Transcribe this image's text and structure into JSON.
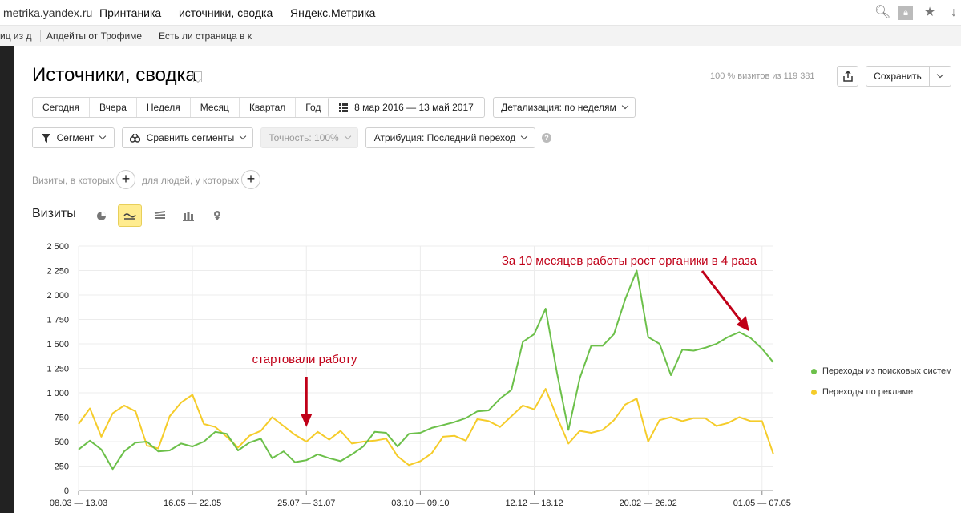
{
  "browser": {
    "url": "metrika.yandex.ru",
    "tab_title": "Принтаника — источники, сводка — Яндекс.Метрика",
    "bookmarks": [
      "иц из д",
      "Апдейты от Трофиме",
      "Есть ли страница в к"
    ],
    "icons": [
      "search-icon",
      "lock-icon",
      "star-icon",
      "download-icon"
    ]
  },
  "page": {
    "title": "Источники, сводка",
    "visits_info": "100 % визитов из 119 381",
    "save_label": "Сохранить"
  },
  "periods": [
    "Сегодня",
    "Вчера",
    "Неделя",
    "Месяц",
    "Квартал",
    "Год"
  ],
  "date_range": "8 мар 2016 — 13 май 2017",
  "detail_label": "Детализация: по неделям",
  "segment_label": "Сегмент",
  "compare_label": "Сравнить сегменты",
  "accuracy_label": "Точность: 100%",
  "attribution_label": "Атрибуция: Последний переход",
  "filters": {
    "visits_label": "Визиты, в которых",
    "people_label": "для людей, у которых"
  },
  "chart_section": {
    "title": "Визиты",
    "types": [
      "pie-chart-icon",
      "line-chart-icon",
      "area-chart-icon",
      "bar-chart-icon",
      "map-icon"
    ]
  },
  "colors": {
    "organic": "#6cc04a",
    "ads": "#f5cc2a",
    "annotation": "#c00018",
    "accent": "#ffec8f"
  },
  "chart_data": {
    "type": "line",
    "ylim": [
      0,
      2500
    ],
    "yticks": [
      0,
      250,
      500,
      750,
      1000,
      1250,
      1500,
      1750,
      2000,
      2250,
      2500
    ],
    "ytick_labels": [
      "0",
      "250",
      "500",
      "750",
      "1 000",
      "1 250",
      "1 500",
      "1 750",
      "2 000",
      "2 250",
      "2 500"
    ],
    "xtick_labels": [
      "08.03 — 13.03",
      "16.05 — 22.05",
      "25.07 — 31.07",
      "03.10 — 09.10",
      "12.12 — 18.12",
      "20.02 — 26.02",
      "01.05 — 07.05"
    ],
    "xtick_positions": [
      0,
      10,
      20,
      30,
      40,
      50,
      60
    ],
    "series": [
      {
        "name": "Переходы из поисковых систем",
        "values": [
          420,
          510,
          420,
          220,
          400,
          490,
          500,
          400,
          410,
          480,
          450,
          500,
          600,
          580,
          410,
          490,
          530,
          330,
          400,
          290,
          310,
          370,
          330,
          300,
          370,
          450,
          600,
          590,
          450,
          580,
          590,
          640,
          670,
          700,
          740,
          810,
          820,
          940,
          1030,
          1520,
          1600,
          1860,
          1200,
          620,
          1150,
          1480,
          1480,
          1600,
          1960,
          2250,
          1570,
          1500,
          1180,
          1440,
          1430,
          1460,
          1500,
          1570,
          1620,
          1560,
          1450,
          1310
        ]
      },
      {
        "name": "Переходы по рекламе",
        "values": [
          680,
          840,
          550,
          790,
          870,
          810,
          460,
          430,
          760,
          900,
          980,
          680,
          650,
          550,
          440,
          560,
          610,
          750,
          660,
          570,
          500,
          600,
          520,
          610,
          480,
          500,
          510,
          530,
          350,
          260,
          300,
          380,
          550,
          560,
          510,
          730,
          710,
          650,
          760,
          870,
          830,
          1040,
          750,
          480,
          610,
          590,
          620,
          720,
          880,
          940,
          500,
          720,
          750,
          710,
          740,
          740,
          660,
          690,
          750,
          710,
          710,
          370
        ]
      }
    ],
    "annotations": [
      {
        "text": "стартовали работу",
        "x": 20,
        "y": 650
      },
      {
        "text": "За 10 месяцев работы рост органики в 4 раза",
        "x": 60,
        "y": 1580
      }
    ],
    "legend_position": "right",
    "grid": true
  }
}
